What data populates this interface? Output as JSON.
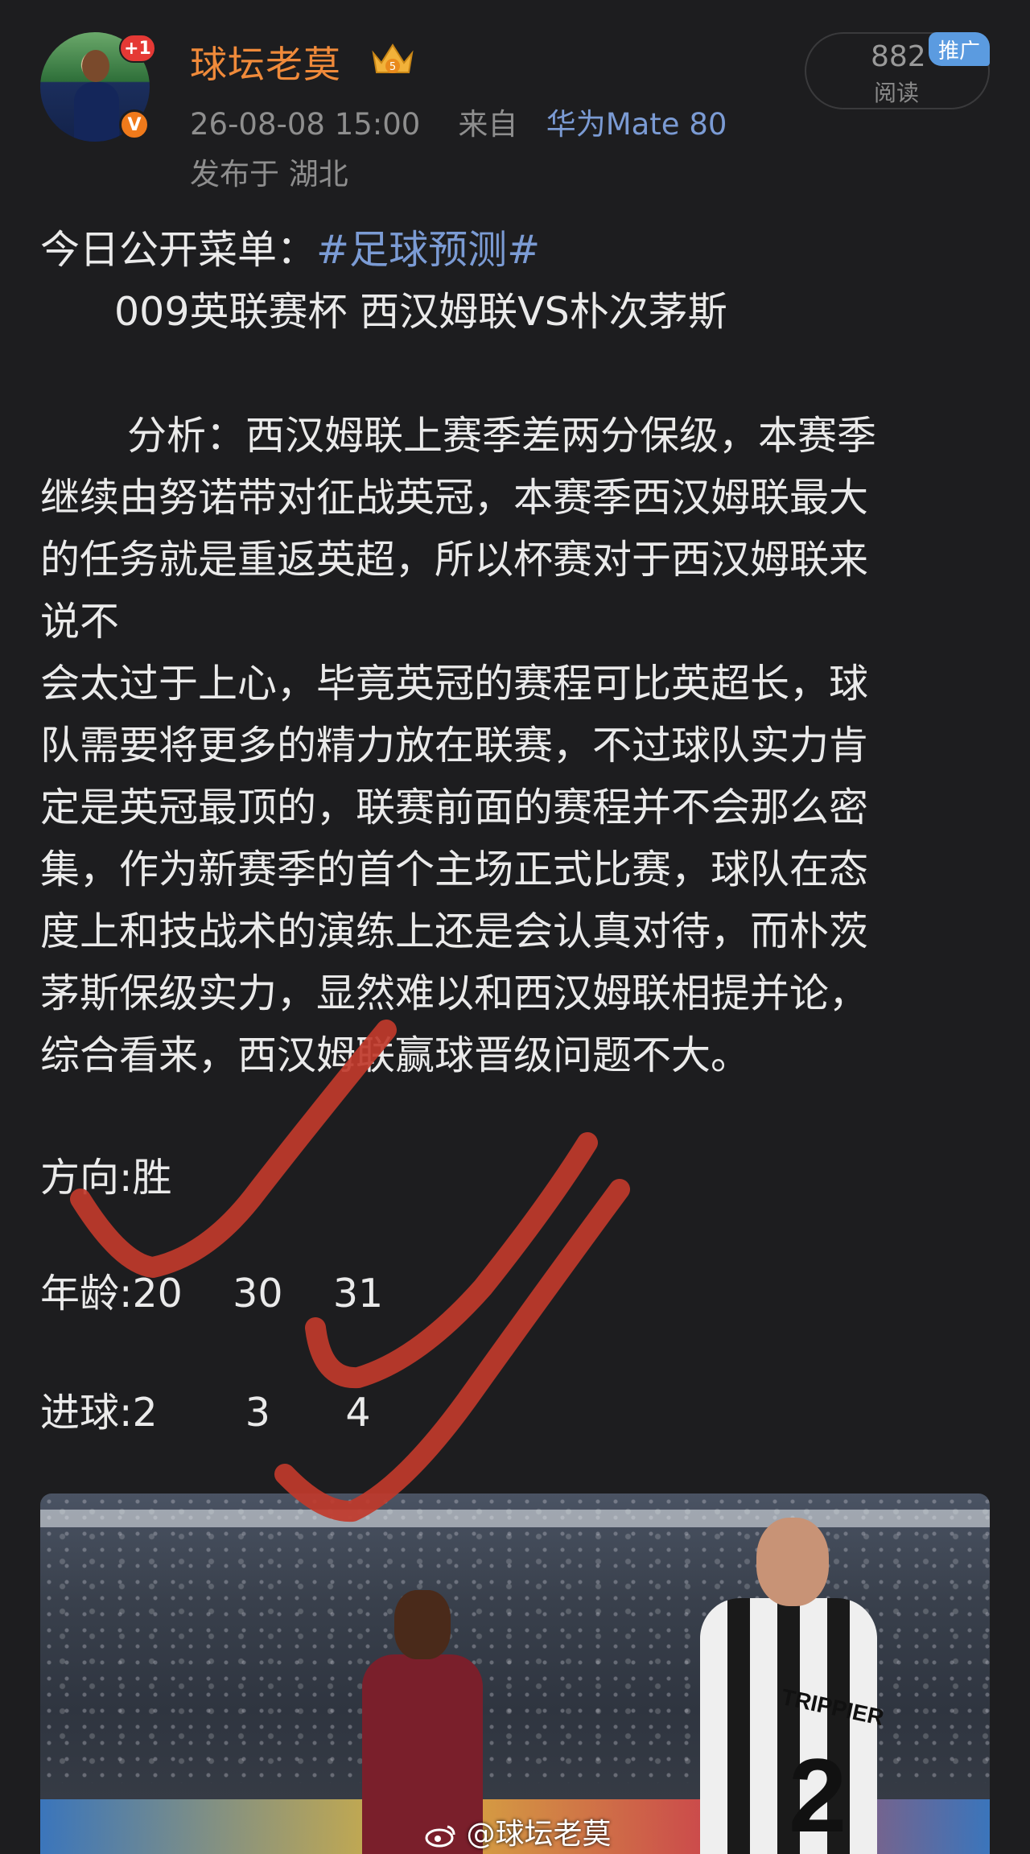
{
  "author": {
    "name": "球坛老莫",
    "avatar_badge": "+1",
    "verified_mark": "V"
  },
  "meta": {
    "time": "26-08-08 15:00",
    "from_label": "来自",
    "device": "华为Mate 80",
    "location": "发布于 湖北"
  },
  "stats": {
    "read_count": "882",
    "read_label": "阅读",
    "promo": "推广"
  },
  "post": {
    "intro": "今日公开菜单：",
    "hashtag": "#足球预测#",
    "match": "009英联赛杯  西汉姆联VS朴次茅斯",
    "analysis_lines": [
      "分析：西汉姆联上赛季差两分保级，本赛季",
      "继续由努诺带对征战英冠，本赛季西汉姆联最大",
      "的任务就是重返英超，所以杯赛对于西汉姆联来",
      "说不",
      "会太过于上心，毕竟英冠的赛程可比英超长，球",
      "队需要将更多的精力放在联赛，不过球队实力肯",
      "定是英冠最顶的，联赛前面的赛程并不会那么密",
      "集，作为新赛季的首个主场正式比赛，球队在态",
      "度上和技战术的演练上还是会认真对待，而朴茨",
      "茅斯保级实力，显然难以和西汉姆联相提并论，",
      "综合看来，西汉姆联赢球晋级问题不大。"
    ],
    "direction": "方向:胜",
    "age": "年龄:20    30    31",
    "goals": "进球:2       3      4"
  },
  "image": {
    "shirt_name": "TRIPPIER",
    "shirt_number": "2",
    "watermark": "@球坛老莫"
  },
  "colors": {
    "background": "#1d1d1f",
    "author_name": "#f08a3a",
    "link": "#7b9bd4",
    "check_marks": "#c0392b"
  }
}
